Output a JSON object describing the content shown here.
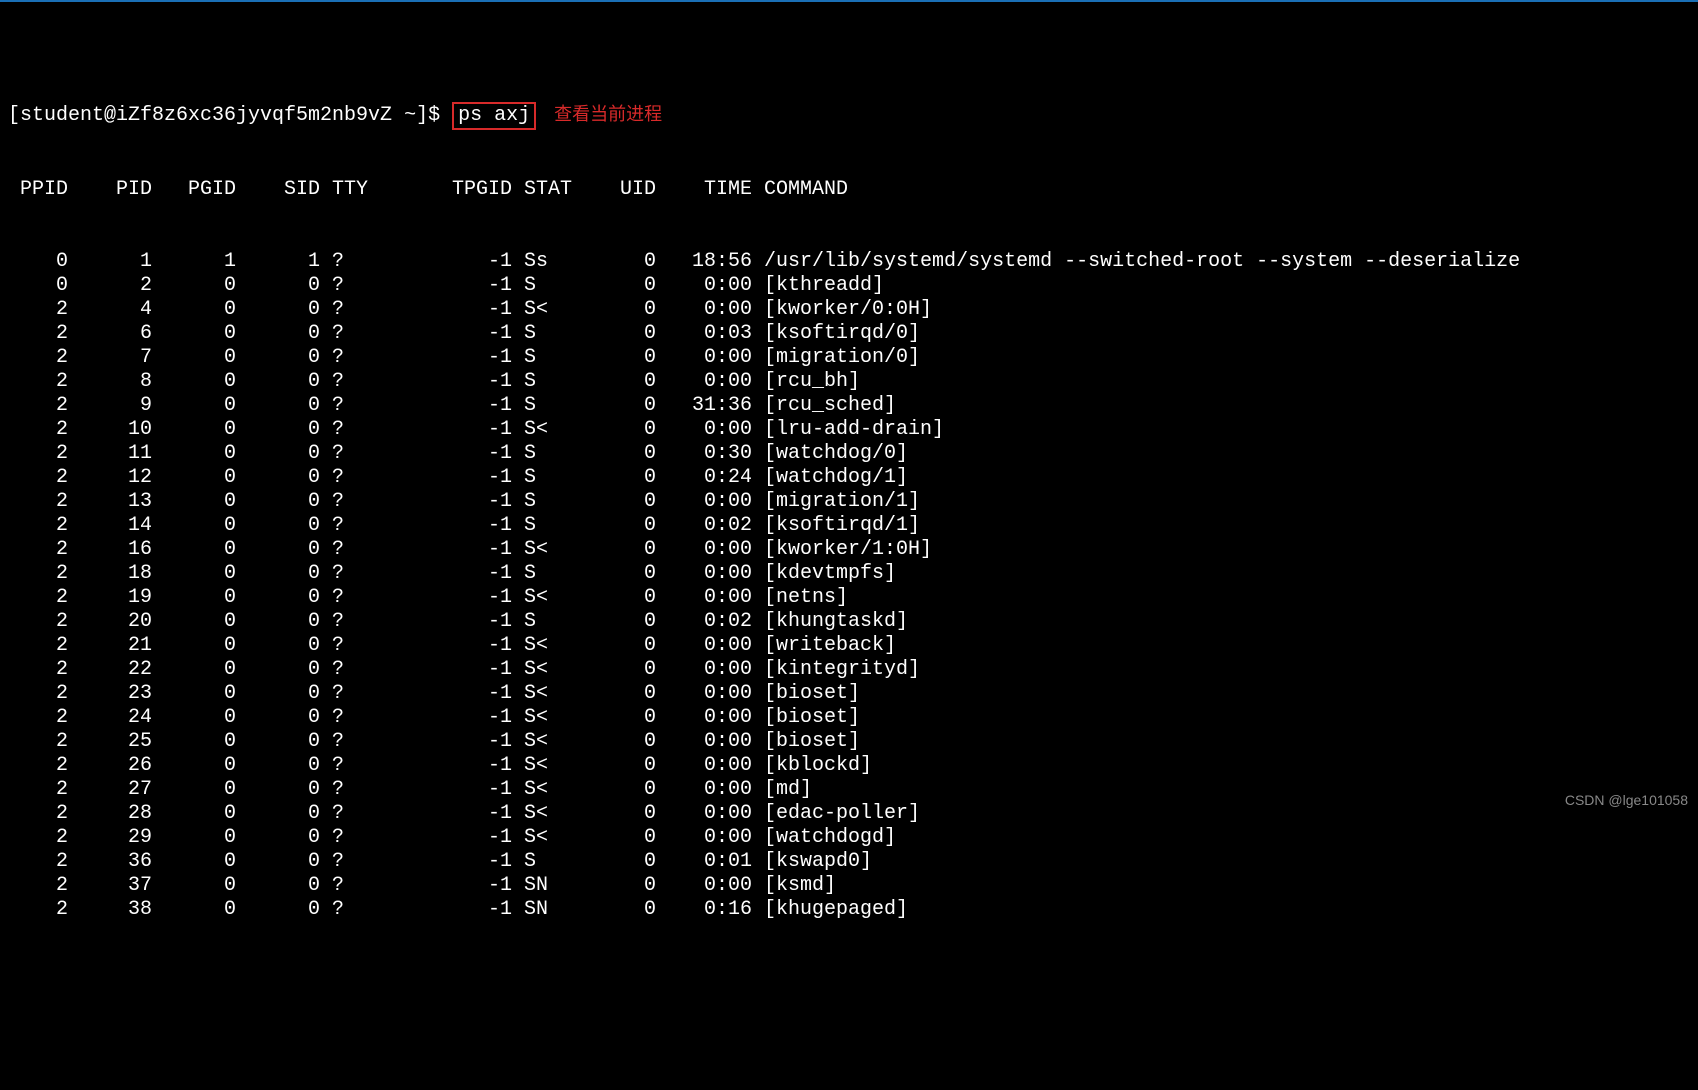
{
  "prompt": {
    "prefix": "[student@iZf8z6xc36jyvqf5m2nb9vZ ~]$ ",
    "command": "ps axj",
    "annotation": "查看当前进程"
  },
  "headers": {
    "ppid": "PPID",
    "pid": "PID",
    "pgid": "PGID",
    "sid": "SID",
    "tty": "TTY",
    "tpgid": "TPGID",
    "stat": "STAT",
    "uid": "UID",
    "time": "TIME",
    "command": "COMMAND"
  },
  "rows": [
    {
      "ppid": "0",
      "pid": "1",
      "pgid": "1",
      "sid": "1",
      "tty": "?",
      "tpgid": "-1",
      "stat": "Ss",
      "uid": "0",
      "time": "18:56",
      "cmd": "/usr/lib/systemd/systemd --switched-root --system --deserialize"
    },
    {
      "ppid": "0",
      "pid": "2",
      "pgid": "0",
      "sid": "0",
      "tty": "?",
      "tpgid": "-1",
      "stat": "S",
      "uid": "0",
      "time": "0:00",
      "cmd": "[kthreadd]"
    },
    {
      "ppid": "2",
      "pid": "4",
      "pgid": "0",
      "sid": "0",
      "tty": "?",
      "tpgid": "-1",
      "stat": "S<",
      "uid": "0",
      "time": "0:00",
      "cmd": "[kworker/0:0H]"
    },
    {
      "ppid": "2",
      "pid": "6",
      "pgid": "0",
      "sid": "0",
      "tty": "?",
      "tpgid": "-1",
      "stat": "S",
      "uid": "0",
      "time": "0:03",
      "cmd": "[ksoftirqd/0]"
    },
    {
      "ppid": "2",
      "pid": "7",
      "pgid": "0",
      "sid": "0",
      "tty": "?",
      "tpgid": "-1",
      "stat": "S",
      "uid": "0",
      "time": "0:00",
      "cmd": "[migration/0]"
    },
    {
      "ppid": "2",
      "pid": "8",
      "pgid": "0",
      "sid": "0",
      "tty": "?",
      "tpgid": "-1",
      "stat": "S",
      "uid": "0",
      "time": "0:00",
      "cmd": "[rcu_bh]"
    },
    {
      "ppid": "2",
      "pid": "9",
      "pgid": "0",
      "sid": "0",
      "tty": "?",
      "tpgid": "-1",
      "stat": "S",
      "uid": "0",
      "time": "31:36",
      "cmd": "[rcu_sched]"
    },
    {
      "ppid": "2",
      "pid": "10",
      "pgid": "0",
      "sid": "0",
      "tty": "?",
      "tpgid": "-1",
      "stat": "S<",
      "uid": "0",
      "time": "0:00",
      "cmd": "[lru-add-drain]"
    },
    {
      "ppid": "2",
      "pid": "11",
      "pgid": "0",
      "sid": "0",
      "tty": "?",
      "tpgid": "-1",
      "stat": "S",
      "uid": "0",
      "time": "0:30",
      "cmd": "[watchdog/0]"
    },
    {
      "ppid": "2",
      "pid": "12",
      "pgid": "0",
      "sid": "0",
      "tty": "?",
      "tpgid": "-1",
      "stat": "S",
      "uid": "0",
      "time": "0:24",
      "cmd": "[watchdog/1]"
    },
    {
      "ppid": "2",
      "pid": "13",
      "pgid": "0",
      "sid": "0",
      "tty": "?",
      "tpgid": "-1",
      "stat": "S",
      "uid": "0",
      "time": "0:00",
      "cmd": "[migration/1]"
    },
    {
      "ppid": "2",
      "pid": "14",
      "pgid": "0",
      "sid": "0",
      "tty": "?",
      "tpgid": "-1",
      "stat": "S",
      "uid": "0",
      "time": "0:02",
      "cmd": "[ksoftirqd/1]"
    },
    {
      "ppid": "2",
      "pid": "16",
      "pgid": "0",
      "sid": "0",
      "tty": "?",
      "tpgid": "-1",
      "stat": "S<",
      "uid": "0",
      "time": "0:00",
      "cmd": "[kworker/1:0H]"
    },
    {
      "ppid": "2",
      "pid": "18",
      "pgid": "0",
      "sid": "0",
      "tty": "?",
      "tpgid": "-1",
      "stat": "S",
      "uid": "0",
      "time": "0:00",
      "cmd": "[kdevtmpfs]"
    },
    {
      "ppid": "2",
      "pid": "19",
      "pgid": "0",
      "sid": "0",
      "tty": "?",
      "tpgid": "-1",
      "stat": "S<",
      "uid": "0",
      "time": "0:00",
      "cmd": "[netns]"
    },
    {
      "ppid": "2",
      "pid": "20",
      "pgid": "0",
      "sid": "0",
      "tty": "?",
      "tpgid": "-1",
      "stat": "S",
      "uid": "0",
      "time": "0:02",
      "cmd": "[khungtaskd]"
    },
    {
      "ppid": "2",
      "pid": "21",
      "pgid": "0",
      "sid": "0",
      "tty": "?",
      "tpgid": "-1",
      "stat": "S<",
      "uid": "0",
      "time": "0:00",
      "cmd": "[writeback]"
    },
    {
      "ppid": "2",
      "pid": "22",
      "pgid": "0",
      "sid": "0",
      "tty": "?",
      "tpgid": "-1",
      "stat": "S<",
      "uid": "0",
      "time": "0:00",
      "cmd": "[kintegrityd]"
    },
    {
      "ppid": "2",
      "pid": "23",
      "pgid": "0",
      "sid": "0",
      "tty": "?",
      "tpgid": "-1",
      "stat": "S<",
      "uid": "0",
      "time": "0:00",
      "cmd": "[bioset]"
    },
    {
      "ppid": "2",
      "pid": "24",
      "pgid": "0",
      "sid": "0",
      "tty": "?",
      "tpgid": "-1",
      "stat": "S<",
      "uid": "0",
      "time": "0:00",
      "cmd": "[bioset]"
    },
    {
      "ppid": "2",
      "pid": "25",
      "pgid": "0",
      "sid": "0",
      "tty": "?",
      "tpgid": "-1",
      "stat": "S<",
      "uid": "0",
      "time": "0:00",
      "cmd": "[bioset]"
    },
    {
      "ppid": "2",
      "pid": "26",
      "pgid": "0",
      "sid": "0",
      "tty": "?",
      "tpgid": "-1",
      "stat": "S<",
      "uid": "0",
      "time": "0:00",
      "cmd": "[kblockd]"
    },
    {
      "ppid": "2",
      "pid": "27",
      "pgid": "0",
      "sid": "0",
      "tty": "?",
      "tpgid": "-1",
      "stat": "S<",
      "uid": "0",
      "time": "0:00",
      "cmd": "[md]"
    },
    {
      "ppid": "2",
      "pid": "28",
      "pgid": "0",
      "sid": "0",
      "tty": "?",
      "tpgid": "-1",
      "stat": "S<",
      "uid": "0",
      "time": "0:00",
      "cmd": "[edac-poller]"
    },
    {
      "ppid": "2",
      "pid": "29",
      "pgid": "0",
      "sid": "0",
      "tty": "?",
      "tpgid": "-1",
      "stat": "S<",
      "uid": "0",
      "time": "0:00",
      "cmd": "[watchdogd]"
    },
    {
      "ppid": "2",
      "pid": "36",
      "pgid": "0",
      "sid": "0",
      "tty": "?",
      "tpgid": "-1",
      "stat": "S",
      "uid": "0",
      "time": "0:01",
      "cmd": "[kswapd0]"
    },
    {
      "ppid": "2",
      "pid": "37",
      "pgid": "0",
      "sid": "0",
      "tty": "?",
      "tpgid": "-1",
      "stat": "SN",
      "uid": "0",
      "time": "0:00",
      "cmd": "[ksmd]"
    },
    {
      "ppid": "2",
      "pid": "38",
      "pgid": "0",
      "sid": "0",
      "tty": "?",
      "tpgid": "-1",
      "stat": "SN",
      "uid": "0",
      "time": "0:16",
      "cmd": "[khugepaged]"
    }
  ],
  "watermark": "CSDN @lge101058"
}
